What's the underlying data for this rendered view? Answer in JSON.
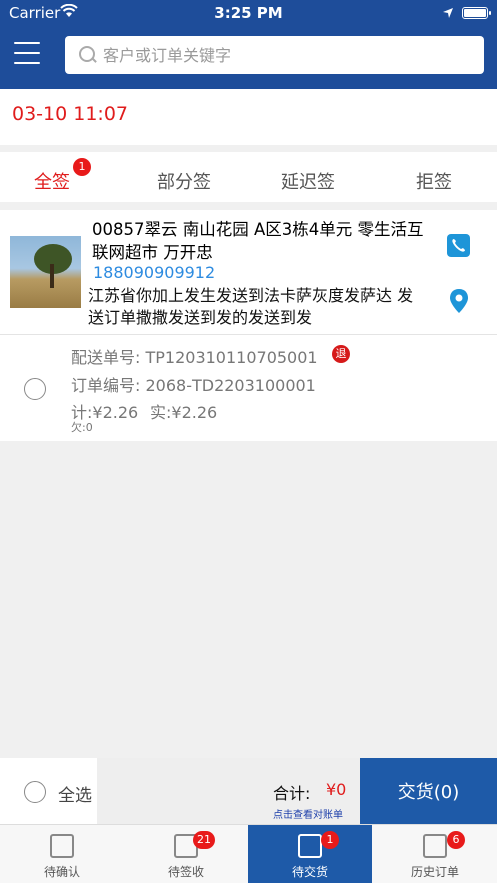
{
  "status_bar": {
    "carrier": "Carrier",
    "time": "3:25 PM"
  },
  "search": {
    "placeholder": "客户或订单关键字"
  },
  "date": "03-10 11:07",
  "tabs": [
    {
      "label": "全签",
      "badge": "1",
      "active": true
    },
    {
      "label": "部分签"
    },
    {
      "label": "延迟签"
    },
    {
      "label": "拒签"
    }
  ],
  "order": {
    "customer": "00857翠云 南山花园 A区3栋4单元 零生活互联网超市 万开忠",
    "phone": "188090909912",
    "address": "江苏省你加上发生发送到法卡萨灰度发萨达 发送订单撒撒发送到发的发送到发",
    "delivery_no": "配送单号: TP120310110705001",
    "return_badge": "退",
    "order_no": "订单编号: 2068-TD2203100001",
    "amount_total": "计:¥2.26",
    "amount_actual": "实:¥2.26",
    "owed": "欠:0"
  },
  "footer": {
    "select_all": "全选",
    "total_label": "合计:",
    "total_value": "¥0",
    "view_bill": "点击查看对账单",
    "deliver_button": "交货(0)"
  },
  "tabbar": [
    {
      "label": "待确认"
    },
    {
      "label": "待签收",
      "badge": "21"
    },
    {
      "label": "待交货",
      "badge": "1",
      "active": true
    },
    {
      "label": "历史订单",
      "badge": "6"
    }
  ],
  "colors": {
    "brand_blue": "#1e4d9a",
    "accent_red": "#e01c1c",
    "link_blue": "#2d8be0"
  }
}
